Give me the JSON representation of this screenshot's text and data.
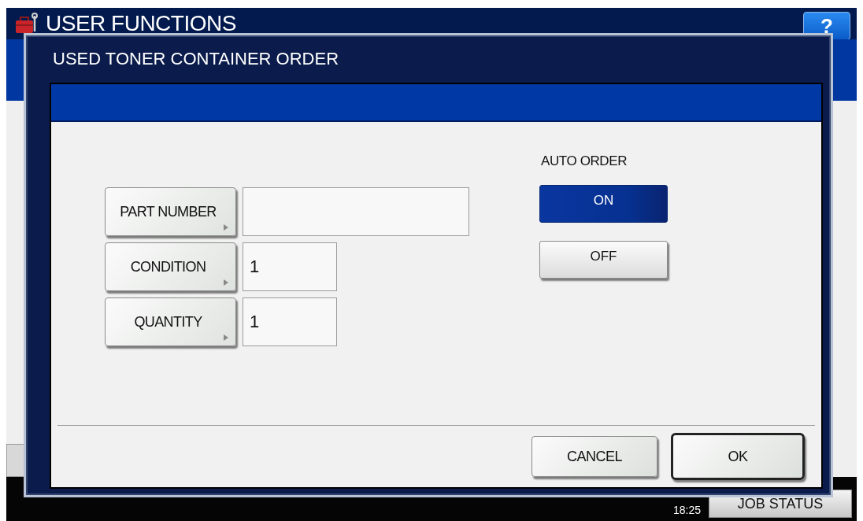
{
  "background_screen": {
    "title": "USER FUNCTIONS",
    "help_button": "?",
    "clock": "18:25",
    "job_status_button": "JOB STATUS"
  },
  "dialog": {
    "title": "USED TONER CONTAINER ORDER",
    "fields": [
      {
        "label": "PART NUMBER",
        "kind": "wide"
      },
      {
        "label": "CONDITION",
        "kind": "short",
        "value": "1"
      },
      {
        "label": "QUANTITY",
        "kind": "short",
        "value": "1"
      }
    ],
    "auto_order": {
      "label": "AUTO ORDER",
      "options": [
        {
          "label": "ON",
          "selected": true
        },
        {
          "label": "OFF",
          "selected": false
        }
      ]
    },
    "buttons": [
      {
        "label": "CANCEL",
        "default": false
      },
      {
        "label": "OK",
        "default": true
      }
    ]
  }
}
